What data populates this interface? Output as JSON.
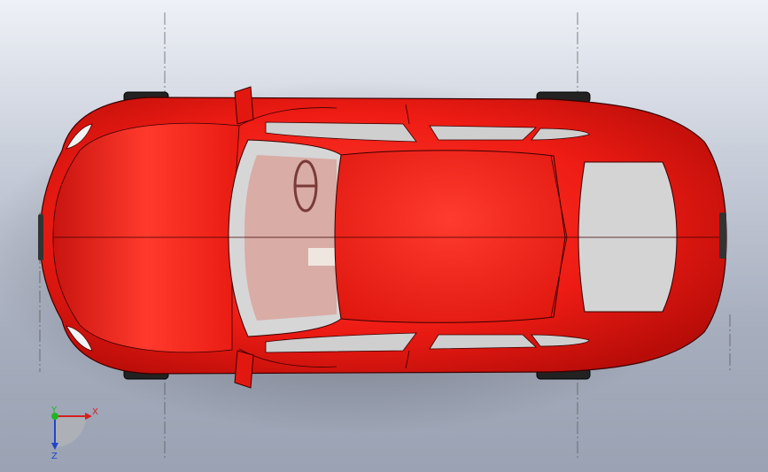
{
  "viewport": {
    "background_top": "#eef1f7",
    "background_bottom": "#9aa2b3"
  },
  "model": {
    "body_color": "#ee1c14",
    "body_highlight": "#ff4a3c",
    "body_shadow": "#b00c08",
    "glass_color": "#cfcfcf",
    "interior_color": "#d9a49e",
    "edge_color": "#3a0000"
  },
  "triad": {
    "x_label": "X",
    "y_label": "Y",
    "z_label": "Z",
    "x_color": "#d42020",
    "y_color": "#22b422",
    "z_color": "#2244cc"
  }
}
